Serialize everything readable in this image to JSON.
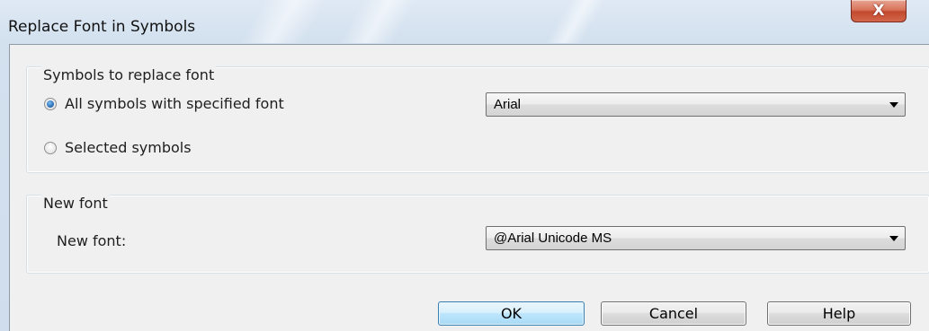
{
  "window": {
    "title": "Replace Font in Symbols",
    "close_glyph": "X",
    "close_icon": "close-icon"
  },
  "group_symbols": {
    "caption": "Symbols to replace font",
    "radio_all": {
      "label": "All symbols with specified font",
      "checked": true
    },
    "radio_selected": {
      "label": "Selected symbols",
      "checked": false
    },
    "font_combo": {
      "value": "Arial"
    }
  },
  "group_new_font": {
    "caption": "New font",
    "label": "New font:",
    "font_combo": {
      "value": "@Arial Unicode MS"
    }
  },
  "buttons": {
    "ok": "OK",
    "cancel": "Cancel",
    "help": "Help"
  },
  "colors": {
    "accent": "#3c7fb1",
    "close": "#c24a2e"
  }
}
